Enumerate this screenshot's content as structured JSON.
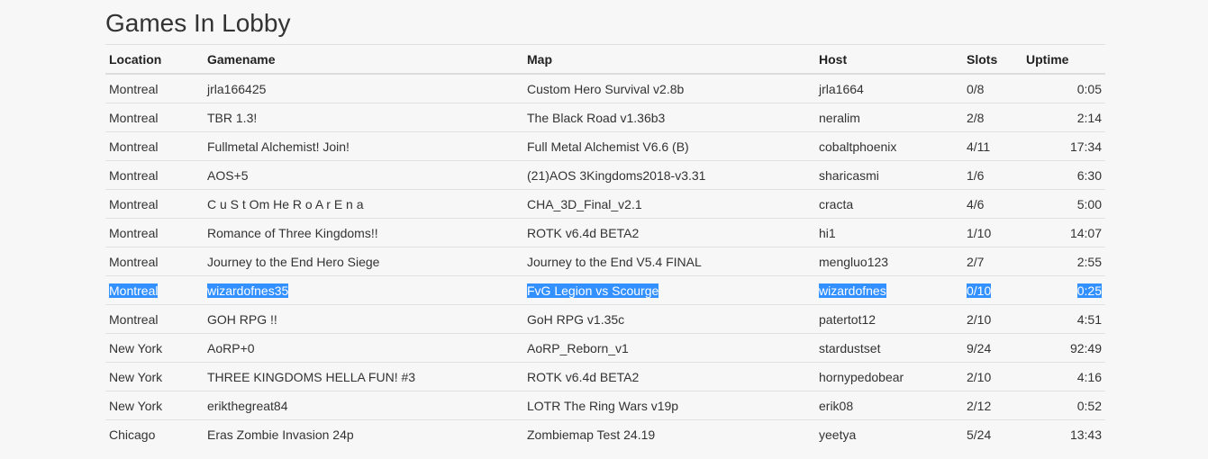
{
  "page": {
    "title": "Games In Lobby"
  },
  "table": {
    "headers": {
      "location": "Location",
      "gamename": "Gamename",
      "map": "Map",
      "host": "Host",
      "slots": "Slots",
      "uptime": "Uptime"
    },
    "rows": [
      {
        "location": "Montreal",
        "gamename": "jrla166425",
        "map": "Custom Hero Survival v2.8b",
        "host": "jrla1664",
        "slots": "0/8",
        "uptime": "0:05"
      },
      {
        "location": "Montreal",
        "gamename": "TBR 1.3!",
        "map": "The Black Road v1.36b3",
        "host": "neralim",
        "slots": "2/8",
        "uptime": "2:14"
      },
      {
        "location": "Montreal",
        "gamename": "Fullmetal Alchemist! Join!",
        "map": "Full Metal Alchemist V6.6 (B)",
        "host": "cobaltphoenix",
        "slots": "4/11",
        "uptime": "17:34"
      },
      {
        "location": "Montreal",
        "gamename": "AOS+5",
        "map": "(21)AOS 3Kingdoms2018-v3.31",
        "host": "sharicasmi",
        "slots": "1/6",
        "uptime": "6:30"
      },
      {
        "location": "Montreal",
        "gamename": "C u S t Om He R o A r E n a",
        "map": "CHA_3D_Final_v2.1",
        "host": "cracta",
        "slots": "4/6",
        "uptime": "5:00"
      },
      {
        "location": "Montreal",
        "gamename": "Romance of Three Kingdoms!!",
        "map": "ROTK v6.4d BETA2",
        "host": "hi1",
        "slots": "1/10",
        "uptime": "14:07"
      },
      {
        "location": "Montreal",
        "gamename": "Journey to the End Hero Siege",
        "map": "Journey to the End V5.4 FINAL",
        "host": "mengluo123",
        "slots": "2/7",
        "uptime": "2:55"
      },
      {
        "location": "Montreal",
        "gamename": "wizardofnes35",
        "map": "FvG Legion vs Scourge",
        "host": "wizardofnes",
        "slots": "0/10",
        "uptime": "0:25"
      },
      {
        "location": "Montreal",
        "gamename": "GOH RPG !!",
        "map": "GoH RPG v1.35c",
        "host": "patertot12",
        "slots": "2/10",
        "uptime": "4:51"
      },
      {
        "location": "New York",
        "gamename": "AoRP+0",
        "map": "AoRP_Reborn_v1",
        "host": "stardustset",
        "slots": "9/24",
        "uptime": "92:49"
      },
      {
        "location": "New York",
        "gamename": "THREE KINGDOMS HELLA FUN! #3",
        "map": "ROTK v6.4d BETA2",
        "host": "hornypedobear",
        "slots": "2/10",
        "uptime": "4:16"
      },
      {
        "location": "New York",
        "gamename": "erikthegreat84",
        "map": "LOTR The Ring Wars v19p",
        "host": "erik08",
        "slots": "2/12",
        "uptime": "0:52"
      },
      {
        "location": "Chicago",
        "gamename": "Eras Zombie Invasion 24p",
        "map": "Zombiemap Test 24.19",
        "host": "yeetya",
        "slots": "5/24",
        "uptime": "13:43"
      }
    ],
    "selected_row": 7
  },
  "colors": {
    "selection": "#3390ff",
    "background": "#f7f7f8",
    "text": "#333333"
  }
}
